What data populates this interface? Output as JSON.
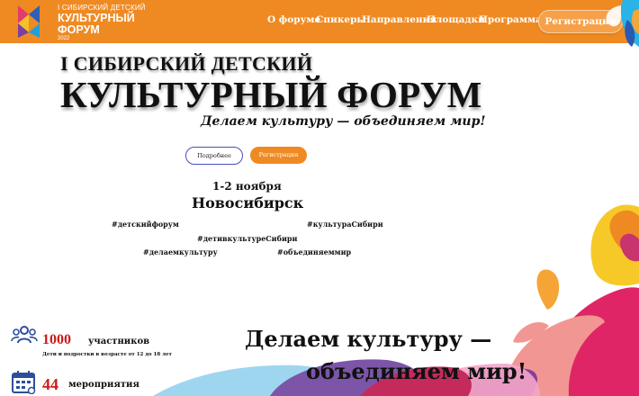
{
  "header": {
    "logo": {
      "line1": "I СИБИРСКИЙ ДЕТСКИЙ",
      "line2": "КУЛЬТУРНЫЙ",
      "line3": "ФОРУМ",
      "year": "2022"
    },
    "nav": [
      "О форуме",
      "Спикеры",
      "Направления",
      "Площадки",
      "Программа"
    ],
    "register_button": "Регистрация",
    "colors": {
      "bar": "#ef8a23",
      "button": "#f6a04a"
    }
  },
  "hero": {
    "title_line1": "I СИБИРСКИЙ ДЕТСКИЙ",
    "title_line2": "КУЛЬТУРНЫЙ ФОРУМ",
    "slogan": "Делаем культуру — объединяем мир!",
    "more_button": "Подробнее",
    "register_button": "Регистрация",
    "date": "1-2 ноября",
    "city": "Новосибирск",
    "hashtags": [
      "#детскийфорум",
      "#культураСибири",
      "#детивкультуреСибири",
      "#делаемкультуру",
      "#объединяеммир"
    ]
  },
  "stats": [
    {
      "icon": "people-icon",
      "number": "1000",
      "label": "участников",
      "sub": "Дети и подростки в возрасте от 12 до 18 лет"
    },
    {
      "icon": "calendar-icon",
      "number": "44",
      "label": "мероприятия",
      "sub": ""
    }
  ],
  "bottom_slogan": {
    "line1": "Делаем культуру —",
    "line2": "объединяем мир!"
  },
  "colors": {
    "accent_orange": "#ef8a23",
    "stat_red": "#d01818",
    "icon_blue": "#2d4f9b"
  }
}
